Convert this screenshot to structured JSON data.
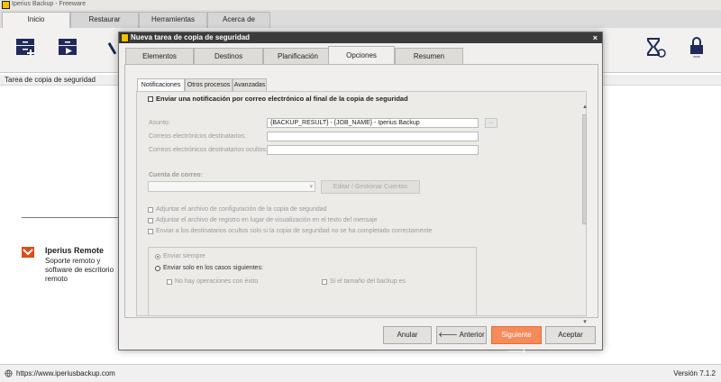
{
  "window": {
    "title": "Iperius Backup - Freeware"
  },
  "main_tabs": [
    {
      "label": "Inicio"
    },
    {
      "label": "Restaurar"
    },
    {
      "label": "Herramientas"
    },
    {
      "label": "Acerca de"
    }
  ],
  "ribbon_icons": [
    "new-backup-icon",
    "run-backup-icon",
    "tool-icon",
    "schedule-icon",
    "lock-icon"
  ],
  "left_panel": {
    "title": "Tarea de copia de seguridad",
    "remote_title": "Iperius Remote",
    "remote_desc": "Soporte remoto y software de escritorio remoto"
  },
  "status": {
    "url": "https://www.iperiusbackup.com",
    "version": "Versión 7.1.2"
  },
  "dialog": {
    "title": "Nueva tarea de copia de seguridad",
    "close": "×",
    "tabs": [
      "Elementos",
      "Destinos",
      "Planificación",
      "Opciones",
      "Resumen"
    ],
    "subtabs": [
      "Notificaciones",
      "Otros procesos",
      "Avanzadas"
    ],
    "email_checkbox_label": "Enviar una notificación por correo electrónico al final de la copia de seguridad",
    "subject_label": "Asunto:",
    "subject_value": "{BACKUP_RESULT} - {JOB_NAME} - Iperius Backup",
    "recipients_label": "Correos electrónicos destinatarios:",
    "hidden_recipients_label": "Correos electrónicos destinatarios ocultos:",
    "account_label": "Cuenta de correo:",
    "manage_accounts_button": "Editar / Gestionar Cuentas",
    "options": [
      "Adjuntar el archivo de configuración de la copia de seguridad",
      "Adjuntar el archivo de registro en lugar de visualización en el texto del mensaje",
      "Enviar a los destinatarios ocultos solo si la copia de seguridad no se ha completado correctamente"
    ],
    "send_always": "Enviar siempre",
    "send_only_cases": "Enviar solo en los casos siguientes:",
    "case_1": "No hay operaciones con éxito",
    "case_2": "Si el tamaño del backup es",
    "buttons": {
      "cancel": "Anular",
      "prev": "Anterior",
      "next": "Siguiente",
      "accept": "Aceptar"
    }
  },
  "colors": {
    "accent": "#f58a5a",
    "dialog_title": "#3b3b3b",
    "icon_blue": "#1f2a5a"
  }
}
